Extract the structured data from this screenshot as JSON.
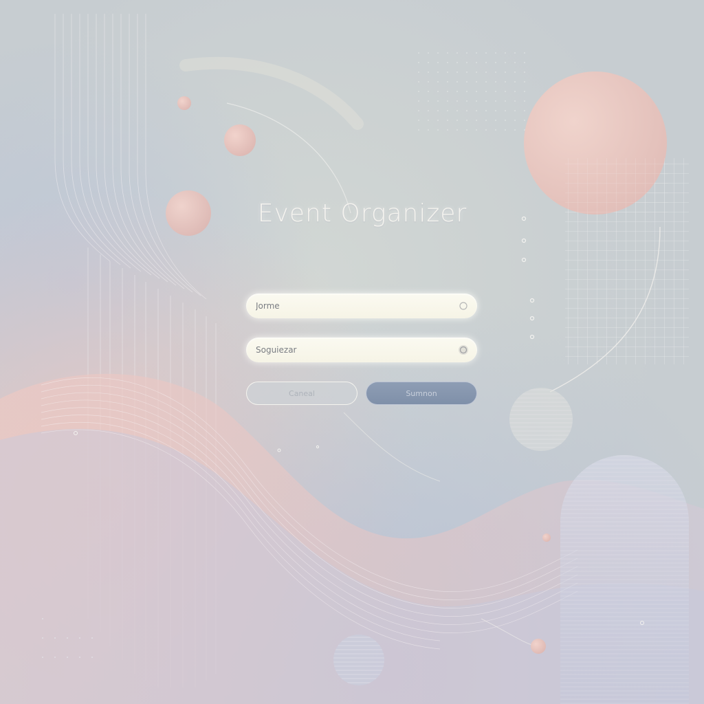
{
  "app": {
    "title": "Event Organizer"
  },
  "form": {
    "username": {
      "placeholder": "Jorme",
      "value": ""
    },
    "password": {
      "placeholder": "Soguiezar",
      "value": ""
    },
    "cancel_label": "Caneal",
    "submit_label": "Sumnon"
  },
  "colors": {
    "background": "#c9cfd2",
    "accent_peach": "#e8c4bd",
    "accent_blue": "#8e9db4",
    "field_fill": "#f8f6ea"
  },
  "icons": {
    "username_field": "circle-dot-icon",
    "password_field": "circle-dot-icon"
  }
}
